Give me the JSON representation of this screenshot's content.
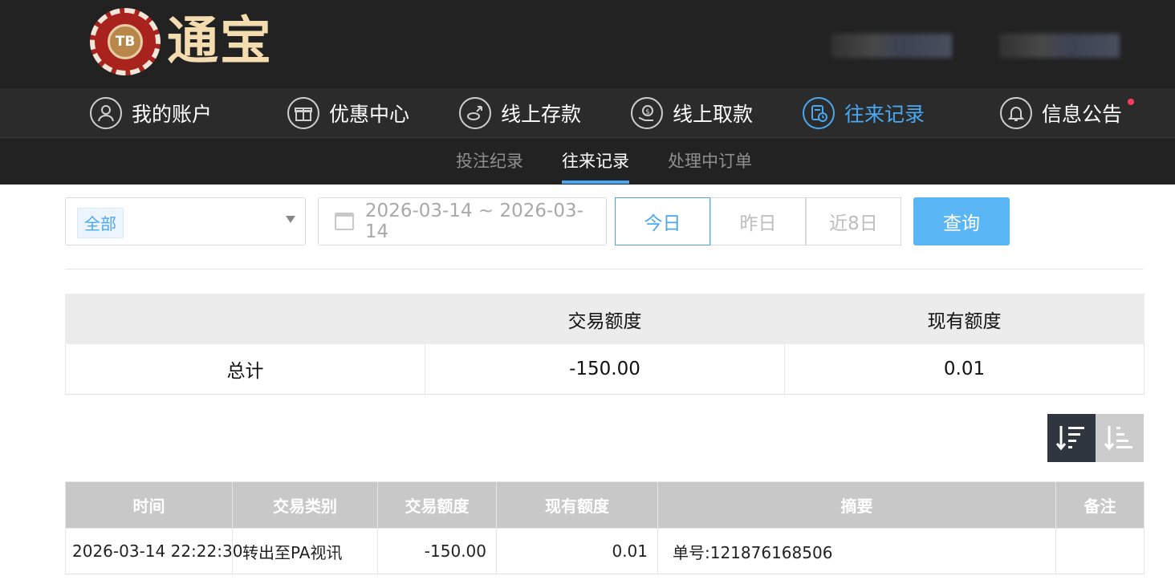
{
  "header": {
    "brand_chip_text": "TB",
    "brand_name": "通宝"
  },
  "main_nav": [
    {
      "label": "我的账户",
      "icon": "user-icon",
      "active": false
    },
    {
      "label": "优惠中心",
      "icon": "gift-icon",
      "active": false
    },
    {
      "label": "线上存款",
      "icon": "deposit-icon",
      "active": false
    },
    {
      "label": "线上取款",
      "icon": "withdraw-icon",
      "active": false
    },
    {
      "label": "往来记录",
      "icon": "records-icon",
      "active": true
    },
    {
      "label": "信息公告",
      "icon": "bell-icon",
      "active": false
    }
  ],
  "sub_nav": [
    {
      "label": "投注纪录",
      "active": false
    },
    {
      "label": "往来记录",
      "active": true
    },
    {
      "label": "处理中订单",
      "active": false
    }
  ],
  "filters": {
    "type_selected": "全部",
    "date_range": "2026-03-14 ~ 2026-03-14",
    "quick_dates": [
      "今日",
      "昨日",
      "近8日"
    ],
    "quick_active": "今日",
    "search_label": "查询"
  },
  "summary": {
    "headers": [
      "",
      "交易额度",
      "现有额度"
    ],
    "row": [
      "总计",
      "-150.00",
      "0.01"
    ]
  },
  "records": {
    "headers": [
      "时间",
      "交易类别",
      "交易额度",
      "现有额度",
      "摘要",
      "备注"
    ],
    "rows": [
      [
        "2026-03-14 22:22:30",
        "转出至PA视讯",
        "-150.00",
        "0.01",
        "单号:121876168506",
        ""
      ]
    ]
  },
  "colors": {
    "accent": "#4aa8f0",
    "topbar_bg": "#222222",
    "nav_bg": "#2b2b2b",
    "search_button": "#5ab6f5",
    "notice_dot": "#ff3b5c"
  }
}
